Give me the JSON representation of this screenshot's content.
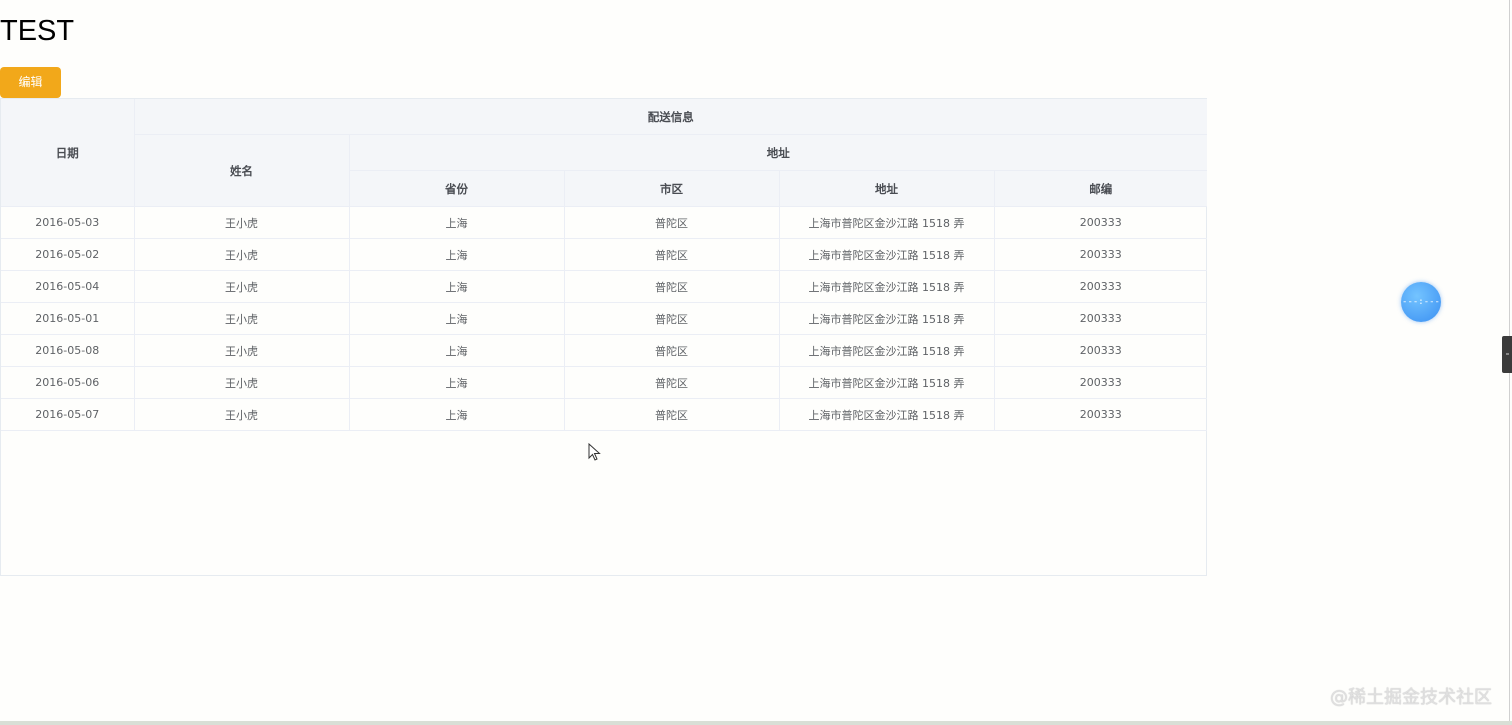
{
  "page": {
    "title": "TEST",
    "edit_label": "编辑"
  },
  "table": {
    "headers": {
      "date": "日期",
      "delivery": "配送信息",
      "name": "姓名",
      "address_group": "地址",
      "province": "省份",
      "city": "市区",
      "address": "地址",
      "zip": "邮编"
    },
    "rows": [
      {
        "date": "2016-05-03",
        "name": "王小虎",
        "province": "上海",
        "city": "普陀区",
        "address": "上海市普陀区金沙江路 1518 弄",
        "zip": "200333"
      },
      {
        "date": "2016-05-02",
        "name": "王小虎",
        "province": "上海",
        "city": "普陀区",
        "address": "上海市普陀区金沙江路 1518 弄",
        "zip": "200333"
      },
      {
        "date": "2016-05-04",
        "name": "王小虎",
        "province": "上海",
        "city": "普陀区",
        "address": "上海市普陀区金沙江路 1518 弄",
        "zip": "200333"
      },
      {
        "date": "2016-05-01",
        "name": "王小虎",
        "province": "上海",
        "city": "普陀区",
        "address": "上海市普陀区金沙江路 1518 弄",
        "zip": "200333"
      },
      {
        "date": "2016-05-08",
        "name": "王小虎",
        "province": "上海",
        "city": "普陀区",
        "address": "上海市普陀区金沙江路 1518 弄",
        "zip": "200333"
      },
      {
        "date": "2016-05-06",
        "name": "王小虎",
        "province": "上海",
        "city": "普陀区",
        "address": "上海市普陀区金沙江路 1518 弄",
        "zip": "200333"
      },
      {
        "date": "2016-05-07",
        "name": "王小虎",
        "province": "上海",
        "city": "普陀区",
        "address": "上海市普陀区金沙江路 1518 弄",
        "zip": "200333"
      }
    ]
  },
  "floating": {
    "ball_text": "---:---"
  },
  "watermark": "@稀土掘金技术社区",
  "colors": {
    "accent": "#f2a81a",
    "header_bg": "#f4f6f9",
    "float_ball": "#3a8ff2"
  }
}
